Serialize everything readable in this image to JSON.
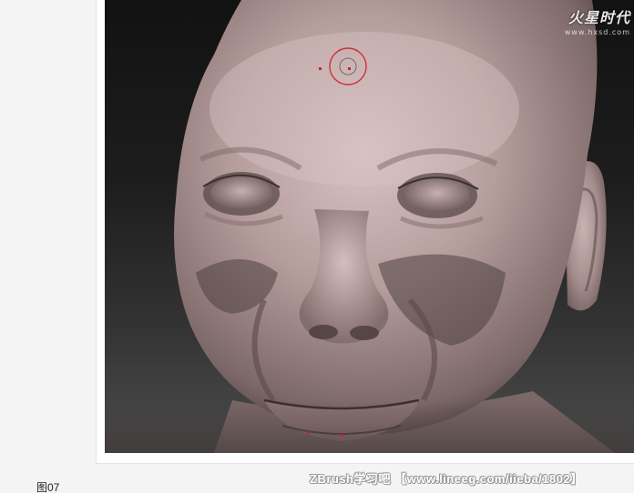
{
  "figure": {
    "caption": "图07",
    "viewport_bg": "#1a1a1a",
    "skin_color": "#a8908f"
  },
  "watermark": {
    "logo_text": "火星时代",
    "url_text": "www.hxsd.com"
  },
  "forum_stamp": {
    "text": "ZBrush学习吧 【www.lineeg.com/iieba/1802】"
  },
  "brush_cursor": {
    "color": "#d0303a",
    "icon": "brush-circle-icon"
  },
  "colors": {
    "page_bg": "#f4f4f4",
    "cursor_red": "#d0303a"
  }
}
